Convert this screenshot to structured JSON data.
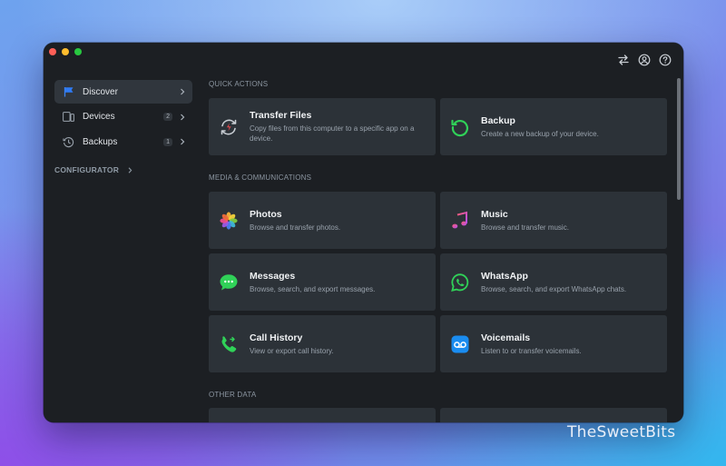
{
  "window": {
    "toolbar_icons": [
      "transfer-arrows-icon",
      "account-icon",
      "help-icon"
    ]
  },
  "sidebar": {
    "items": [
      {
        "label": "Discover",
        "icon": "flag-icon",
        "active": true
      },
      {
        "label": "Devices",
        "icon": "devices-icon",
        "badge": "2"
      },
      {
        "label": "Backups",
        "icon": "backup-clock-icon",
        "badge": "1"
      }
    ],
    "section_label": "CONFIGURATOR"
  },
  "main": {
    "sections": [
      {
        "title": "QUICK ACTIONS",
        "cards": [
          {
            "title": "Transfer Files",
            "desc": "Copy files from this computer to a specific app on a device.",
            "icon": "transfer-files-icon"
          },
          {
            "title": "Backup",
            "desc": "Create a new backup of your device.",
            "icon": "backup-icon"
          }
        ]
      },
      {
        "title": "MEDIA & COMMUNICATIONS",
        "cards": [
          {
            "title": "Photos",
            "desc": "Browse and transfer photos.",
            "icon": "photos-icon"
          },
          {
            "title": "Music",
            "desc": "Browse and transfer music.",
            "icon": "music-icon"
          },
          {
            "title": "Messages",
            "desc": "Browse, search, and export messages.",
            "icon": "messages-icon"
          },
          {
            "title": "WhatsApp",
            "desc": "Browse, search, and export WhatsApp chats.",
            "icon": "whatsapp-icon"
          },
          {
            "title": "Call History",
            "desc": "View or export call history.",
            "icon": "phone-icon"
          },
          {
            "title": "Voicemails",
            "desc": "Listen to or transfer voicemails.",
            "icon": "voicemail-icon"
          }
        ]
      },
      {
        "title": "OTHER DATA",
        "cards": []
      }
    ]
  },
  "watermark": "TheSweetBits",
  "colors": {
    "window_bg": "#1c1f23",
    "card_bg": "#2c3238",
    "sidebar_active": "#30363d",
    "accent_blue": "#2f7bf5",
    "accent_green": "#30d158"
  }
}
